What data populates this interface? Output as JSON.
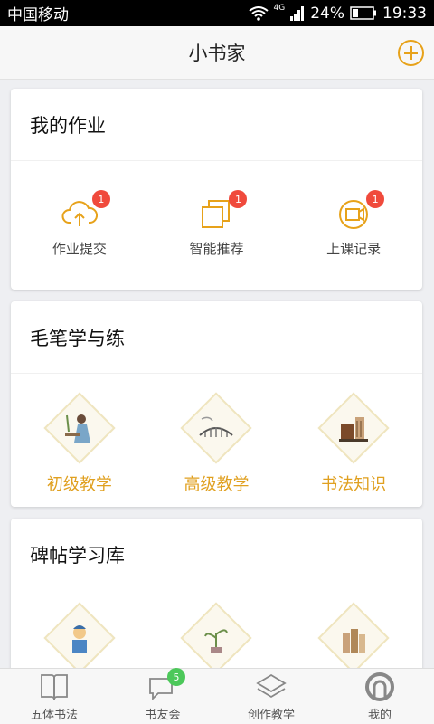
{
  "statusbar": {
    "carrier": "中国移动",
    "network": "4G",
    "battery": "24%",
    "time": "19:33"
  },
  "appbar": {
    "title": "小书家"
  },
  "homework": {
    "title": "我的作业",
    "items": [
      {
        "label": "作业提交",
        "badge": "1",
        "icon": "cloud-upload-icon"
      },
      {
        "label": "智能推荐",
        "badge": "1",
        "icon": "stacked-squares-icon"
      },
      {
        "label": "上课记录",
        "badge": "1",
        "icon": "record-icon"
      }
    ]
  },
  "brush": {
    "title": "毛笔学与练",
    "items": [
      {
        "label": "初级教学"
      },
      {
        "label": "高级教学"
      },
      {
        "label": "书法知识"
      }
    ]
  },
  "library": {
    "title": "碑帖学习库"
  },
  "tabbar": {
    "items": [
      {
        "label": "五体书法",
        "icon": "book-icon"
      },
      {
        "label": "书友会",
        "icon": "chat-icon",
        "badge": "5"
      },
      {
        "label": "创作教学",
        "icon": "layers-icon"
      },
      {
        "label": "我的",
        "icon": "profile-icon"
      }
    ]
  },
  "colors": {
    "accent": "#e7a21a",
    "badge": "#f04a3c",
    "badge_green": "#4cc85a"
  }
}
